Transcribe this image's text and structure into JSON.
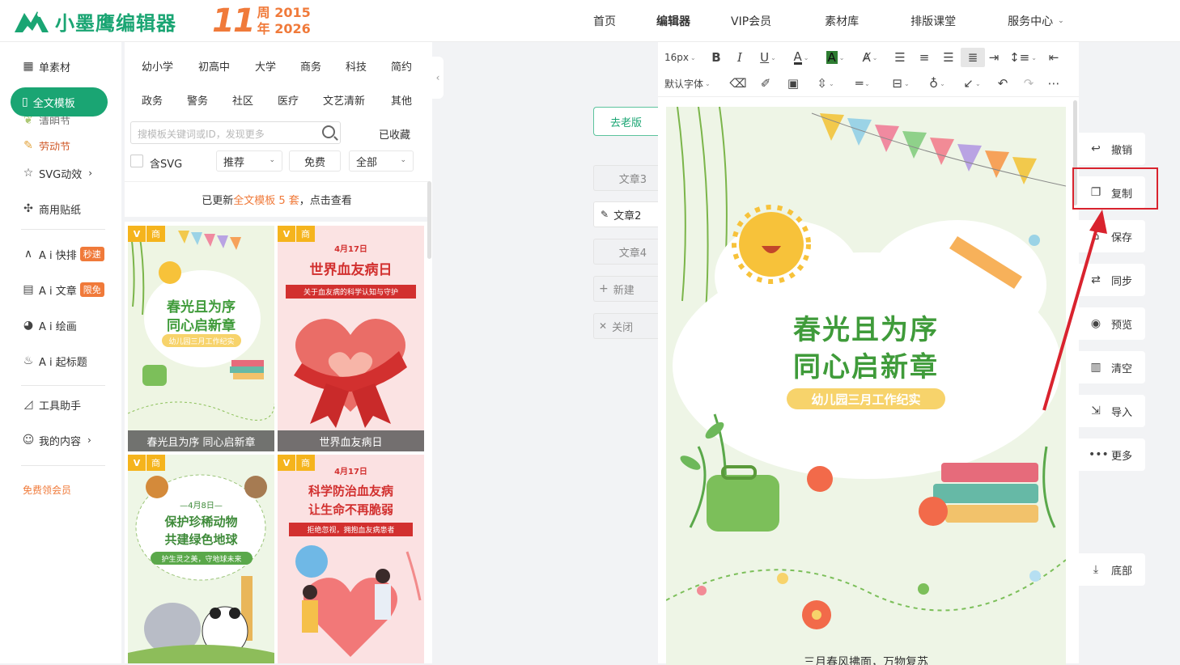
{
  "header": {
    "logo_text": "小墨鹰编辑器",
    "anniversary_number": "11",
    "anniversary_unit1": "周",
    "anniversary_year1": "2015",
    "anniversary_unit2": "年",
    "anniversary_year2": "2026",
    "nav": [
      "首页",
      "编辑器",
      "VIP会员",
      "素材库",
      "排版课堂",
      "服务中心"
    ]
  },
  "sidebar": {
    "items": [
      {
        "label": "单素材"
      },
      {
        "label": "全文模板"
      },
      {
        "label": "清明节"
      },
      {
        "label": "劳动节"
      },
      {
        "label": "SVG动效"
      },
      {
        "label": "商用贴纸"
      },
      {
        "label": "A i 快排",
        "badge": "秒速"
      },
      {
        "label": "A i 文章",
        "badge": "限免"
      },
      {
        "label": "A i 绘画"
      },
      {
        "label": "A i 起标题"
      },
      {
        "label": "工具助手"
      },
      {
        "label": "我的内容"
      },
      {
        "label": "免费领会员"
      }
    ]
  },
  "panel": {
    "categories_row1": [
      "幼小学",
      "初高中",
      "大学",
      "商务",
      "科技",
      "简约"
    ],
    "categories_row2": [
      "政务",
      "警务",
      "社区",
      "医疗",
      "文艺清新",
      "其他"
    ],
    "search_placeholder": "搜模板关键词或ID，发现更多",
    "favorites": "已收藏",
    "svg_checkbox": "含SVG",
    "filter_sort": "推荐",
    "filter_price": "免费",
    "filter_range": "全部",
    "notice_prefix": "已更新 ",
    "notice_highlight": "全文模板 5 套",
    "notice_suffix": "，点击查看",
    "tag_v": "V",
    "tag_commercial": "商",
    "cards": [
      {
        "caption": "春光且为序 同心启新章",
        "title1": "春光且为序",
        "title2": "同心启新章",
        "sub": "幼儿园三月工作纪实"
      },
      {
        "caption": "世界血友病日",
        "date": "4月17日",
        "title1": "世界血友病日",
        "sub": "关于血友病的科学认知与守护"
      },
      {
        "date": "—4月8日—",
        "title1": "保护珍稀动物",
        "title2": "共建绿色地球",
        "sub": "护生灵之美，守地球未来"
      },
      {
        "date": "4月17日",
        "title1": "科学防治血友病",
        "title2": "让生命不再脆弱",
        "sub": "拒绝忽视，拥抱血友病患者"
      }
    ]
  },
  "docs": {
    "old_version": "去老版",
    "items": [
      "文章3",
      "文章2",
      "文章4"
    ],
    "new": "新建",
    "close": "关闭"
  },
  "toolbar": {
    "font_size": "16px",
    "font_family": "默认字体"
  },
  "canvas": {
    "title1": "春光且为序",
    "title2": "同心启新章",
    "subtitle": "幼儿园三月工作纪实",
    "footer_text": "三月春风拂面，万物复苏"
  },
  "actions": [
    "撤销",
    "复制",
    "保存",
    "同步",
    "预览",
    "清空",
    "导入",
    "更多",
    "底部"
  ],
  "colors": {
    "brand": "#1aa573",
    "accent": "#f07a3a",
    "highlight_box": "#d9232e"
  }
}
